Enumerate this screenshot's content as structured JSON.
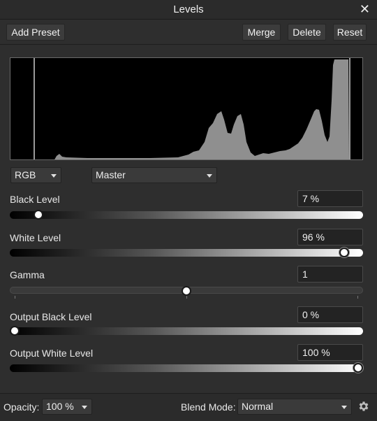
{
  "window": {
    "title": "Levels",
    "close_glyph": "✕"
  },
  "toolbar": {
    "add_preset": "Add Preset",
    "merge": "Merge",
    "delete": "Delete",
    "reset": "Reset"
  },
  "channel_select": {
    "value": "RGB"
  },
  "mode_select": {
    "value": "Master"
  },
  "sliders": {
    "black_level": {
      "label": "Black Level",
      "value": "7 %",
      "position": 0.07
    },
    "white_level": {
      "label": "White Level",
      "value": "96 %",
      "position": 0.96
    },
    "gamma": {
      "label": "Gamma",
      "value": "1",
      "position": 0.5
    },
    "output_black": {
      "label": "Output Black Level",
      "value": "0 %",
      "position": 0.0
    },
    "output_white": {
      "label": "Output White Level",
      "value": "100 %",
      "position": 1.0
    }
  },
  "footer": {
    "opacity_label": "Opacity:",
    "opacity_value": "100 %",
    "blend_label": "Blend Mode:",
    "blend_value": "Normal",
    "settings_icon": "gear-icon"
  },
  "colors": {
    "panel": "#2e2e2e",
    "histogram_fill": "#8f8f8f",
    "histogram_bg": "#000000",
    "input_bg": "#232323"
  }
}
